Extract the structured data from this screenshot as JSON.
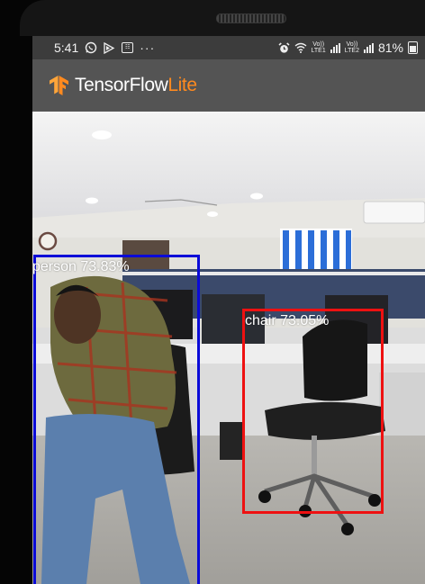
{
  "status_bar": {
    "time": "5:41",
    "icons": [
      "whatsapp-icon",
      "cast-icon",
      "message-icon",
      "more-icon"
    ],
    "more": "···",
    "message_glyph": "☷",
    "net1": {
      "top": "Vo))",
      "bottom": "LTE1"
    },
    "net2": {
      "top": "Vo))",
      "bottom": "LTE2"
    },
    "battery": "81%"
  },
  "app": {
    "title_primary": "TensorFlow",
    "title_secondary": "Lite",
    "title_primary_color": "#ffffff",
    "title_secondary_color": "#ff8a1f"
  },
  "detections": [
    {
      "label": "person 73.83%",
      "color": "#0a0ad8"
    },
    {
      "label": "chair 73.05%",
      "color": "#ee1111"
    }
  ]
}
